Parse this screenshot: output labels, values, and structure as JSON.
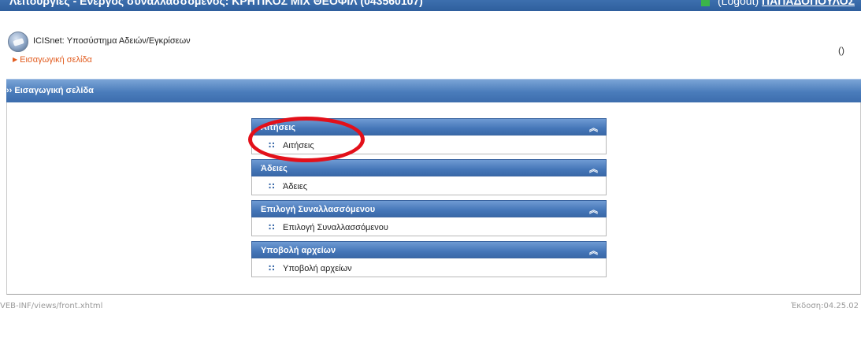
{
  "top_bar": {
    "left_text": "Λειτουργίες - Ενεργός συναλλασσόμενος: ΚΡΗΤΙΚΟΣ ΜΙΧ ΘΕΟΦΙΛ (043560107)",
    "right_text": "(Logout)",
    "user_text": "ΠΑΠΑΔΟΠΟΥΛΟΣ"
  },
  "header": {
    "app_title": "ICISnet: Υποσύστημα Αδειών/Εγκρίσεων",
    "home_link": "Εισαγωγική σελίδα",
    "paren": "()"
  },
  "breadcrumb": "›› Εισαγωγική σελίδα",
  "menu": [
    {
      "header": "Αιτήσεις",
      "item": "Αιτήσεις"
    },
    {
      "header": "Άδειες",
      "item": "Άδειες"
    },
    {
      "header": "Επιλογή Συναλλασσόμενου",
      "item": "Επιλογή Συναλλασσόμενου"
    },
    {
      "header": "Υποβολή αρχείων",
      "item": "Υποβολή αρχείων"
    }
  ],
  "footer": {
    "path": "VEB-INF/views/front.xhtml",
    "version": "Έκδοση:04.25.02"
  },
  "colors": {
    "panel_blue": "#4576b8",
    "link_orange": "#e25c1f",
    "annotation_red": "#e3101a",
    "online_green": "#3bb54a"
  },
  "icons": {
    "logo": "globe-icon",
    "collapse": "double-chevron-up-icon",
    "bullet": "square-bullet-icon",
    "status": "online-status-icon"
  }
}
